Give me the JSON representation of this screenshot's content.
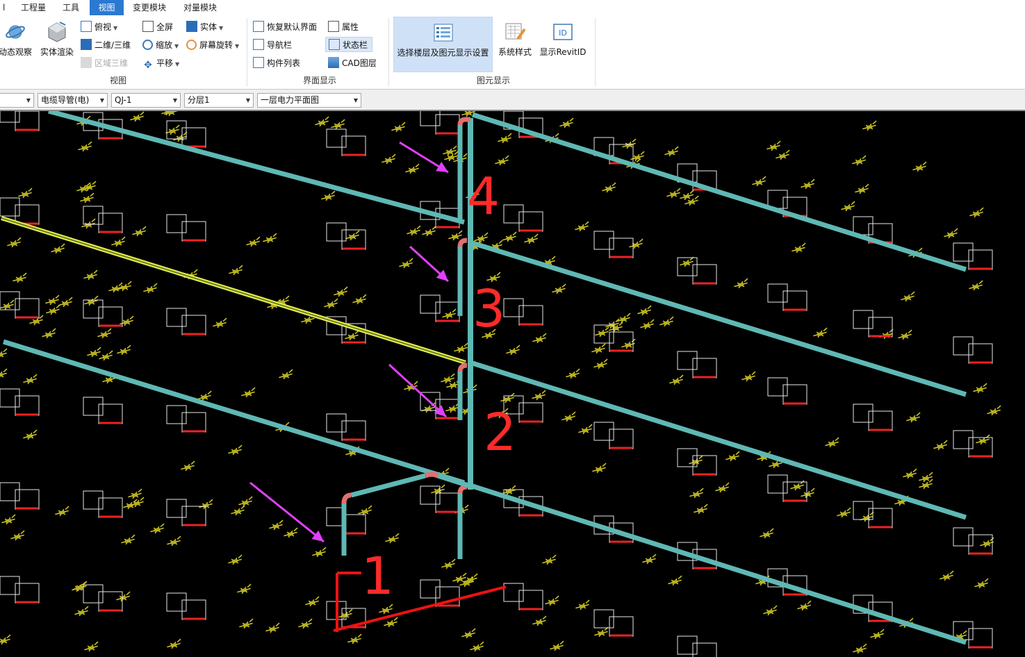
{
  "menu": {
    "items": [
      "l",
      "工程量",
      "工具",
      "视图",
      "变更模块",
      "对量模块"
    ],
    "active_index": 3
  },
  "ribbon": {
    "view_group": {
      "label": "视图",
      "dynamic_observe": "动态观察",
      "solid_render": "实体渲染",
      "top_view": "俯视",
      "two_three_d": "二维/三维",
      "region_3d": "区域三维",
      "full_screen": "全屏",
      "zoom": "缩放",
      "pan": "平移",
      "solid": "实体",
      "screen_rotate": "屏幕旋转"
    },
    "ui_group": {
      "label": "界面显示",
      "restore_default": "恢复默认界面",
      "nav_bar": "导航栏",
      "component_list": "构件列表",
      "properties": "属性",
      "status_bar": "状态栏",
      "cad_layer": "CAD图层"
    },
    "element_group": {
      "label": "图元显示",
      "select_floor": "选择楼层及图元显示设置",
      "system_style": "系统样式",
      "show_revit_id": "显示RevitID"
    }
  },
  "toolbar": {
    "combo_type": "电缆导管(电)",
    "combo_component": "QJ-1",
    "combo_layer": "分层1",
    "combo_drawing": "一层电力平面图"
  },
  "annotations": {
    "label_1": "1",
    "label_2": "2",
    "label_3": "3",
    "label_4": "4"
  },
  "colors": {
    "menu_active": "#2b79d0",
    "conduit": "#5fb8b4",
    "highlight_conduit": "#e8f04a",
    "annotation": "#ff2a2a",
    "arrow": "#e040fb",
    "symbol": "#c9c224"
  }
}
